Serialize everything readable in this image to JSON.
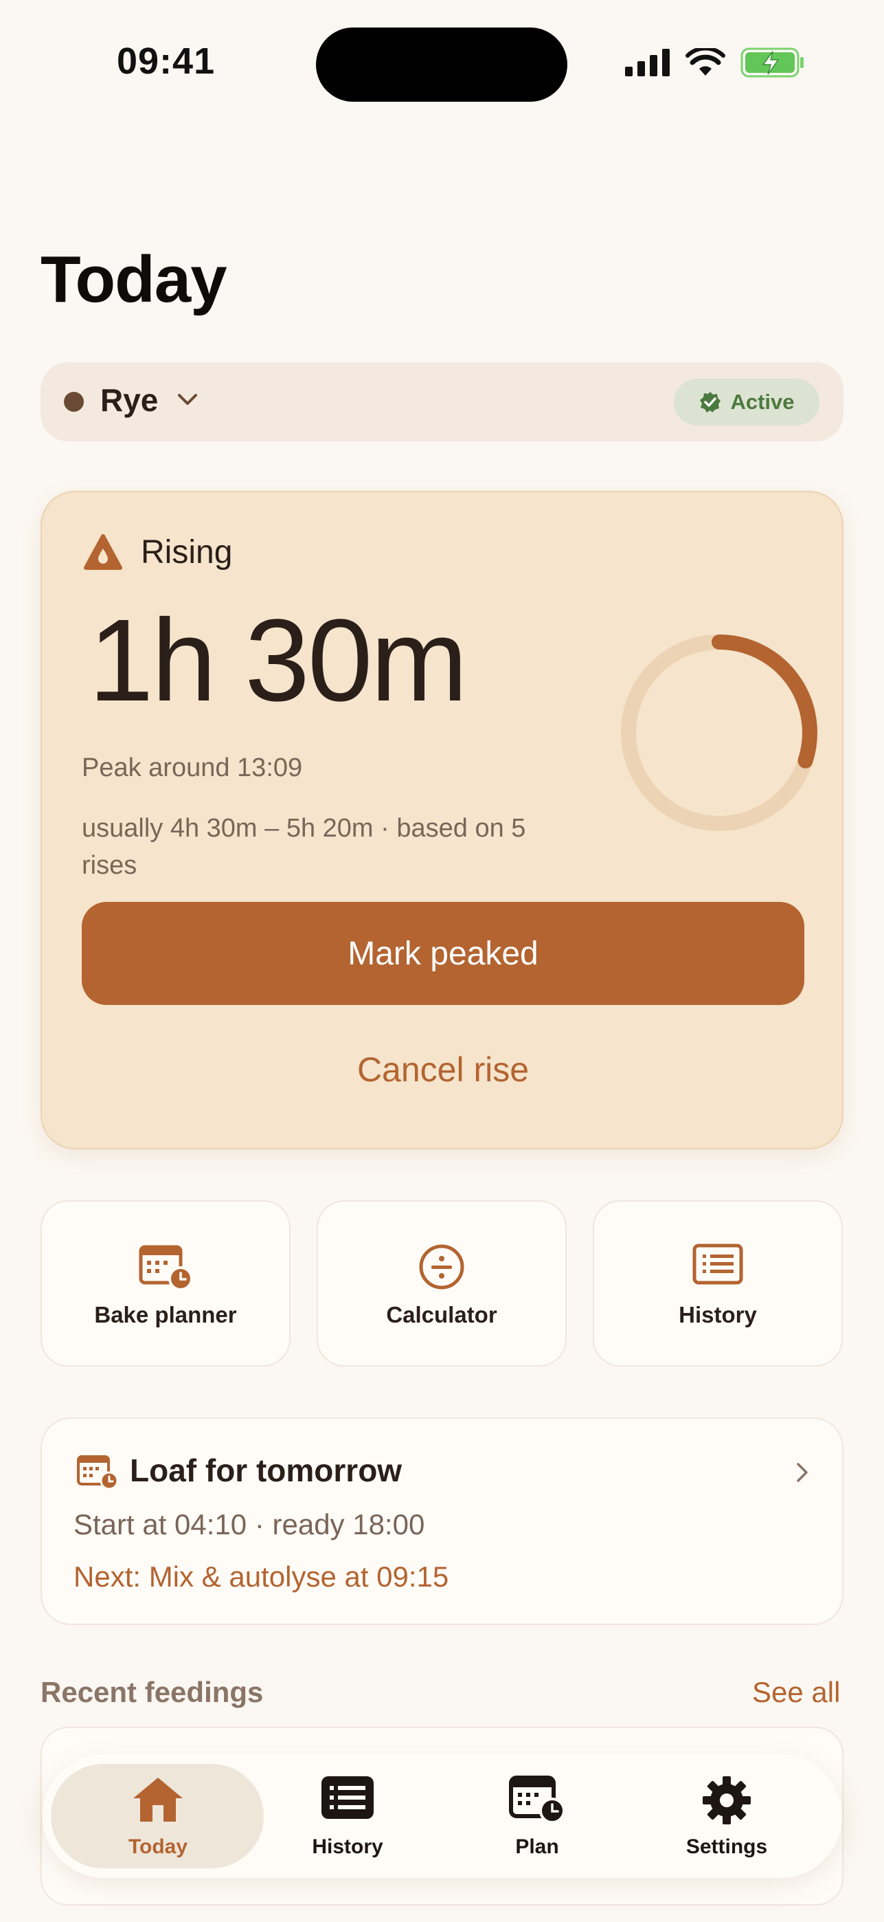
{
  "status_bar": {
    "time": "09:41"
  },
  "page": {
    "title": "Today"
  },
  "starter": {
    "name": "Rye",
    "status": "Active"
  },
  "rise": {
    "state_label": "Rising",
    "elapsed": "1h 30m",
    "peak_estimate": "Peak around 13:09",
    "usual_range": "usually 4h 30m – 5h 20m · based on 5 rises",
    "progress": 0.3,
    "primary_action": "Mark peaked",
    "secondary_action": "Cancel rise"
  },
  "quick_actions": [
    {
      "label": "Bake planner",
      "icon": "calendar-clock-icon"
    },
    {
      "label": "Calculator",
      "icon": "divide-icon"
    },
    {
      "label": "History",
      "icon": "list-icon"
    }
  ],
  "loaf": {
    "title": "Loaf for tomorrow",
    "schedule": "Start at 04:10 · ready 18:00",
    "next_step": "Next: Mix & autolyse at 09:15"
  },
  "recent": {
    "title": "Recent feedings",
    "see_all": "See all"
  },
  "tabs": [
    {
      "label": "Today",
      "icon": "home-icon",
      "active": true
    },
    {
      "label": "History",
      "icon": "list-icon",
      "active": false
    },
    {
      "label": "Plan",
      "icon": "calendar-clock-icon",
      "active": false
    },
    {
      "label": "Settings",
      "icon": "gear-icon",
      "active": false
    }
  ],
  "colors": {
    "accent": "#b36430",
    "background": "#fbf7f2",
    "card": "#f6e4cc",
    "active_green": "#4b7a3e"
  }
}
